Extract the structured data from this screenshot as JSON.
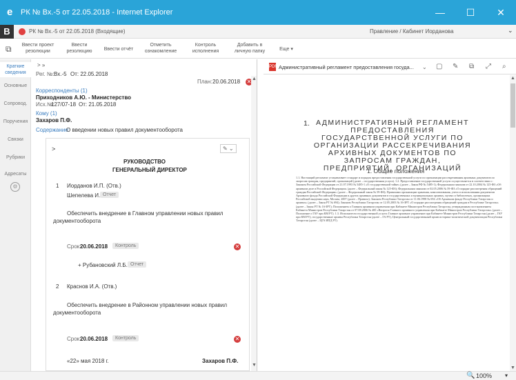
{
  "window": {
    "title": "РК № Вх.-5 от 22.05.2018 - Internet Explorer",
    "minimize": "—",
    "maximize": "☐",
    "close": "✕"
  },
  "tabbar": {
    "logo": "B",
    "tab_title": "РК № Вх.-5 от 22.05.2018 (Входящие)",
    "user": "Правление / Кабинет Иорданова",
    "user_chevron": "⌄"
  },
  "toolbar": {
    "buttons": [
      {
        "line1": "Ввести проект",
        "line2": "резолюции"
      },
      {
        "line1": "Ввести",
        "line2": "резолюцию"
      },
      {
        "line1": "Ввести отчёт",
        "line2": ""
      },
      {
        "line1": "Отметить",
        "line2": "ознакомление"
      },
      {
        "line1": "Контроль",
        "line2": "исполнения"
      },
      {
        "line1": "Добавить в",
        "line2": "личную папку"
      },
      {
        "line1": "Еще ▾",
        "line2": ""
      }
    ]
  },
  "leftnav": {
    "items": [
      {
        "line1": "Краткие",
        "line2": "сведения"
      },
      {
        "line1": "Основные",
        "line2": ""
      },
      {
        "line1": "Сопровод.",
        "line2": ""
      },
      {
        "line1": "Поручения",
        "line2": ""
      },
      {
        "line1": "Связки",
        "line2": ""
      },
      {
        "line1": "Рубрики",
        "line2": ""
      },
      {
        "line1": "Адресаты",
        "line2": ""
      }
    ],
    "gear": "⚙"
  },
  "doc": {
    "nav_arrows": "> »",
    "reg_label": "Рег. №:",
    "reg_number": "Вх.-5",
    "reg_date": "От: 22.05.2018",
    "plan_label": "План:",
    "plan_date": "20.06.2018",
    "correspondents_label": "Корреспонденты (1)",
    "correspondent": "Приходников А.Ю. - Министерство",
    "outgoing_label": "Исх.№:",
    "outgoing_number": "127/07-18",
    "outgoing_date": "От: 21.05.2018",
    "to_label": "Кому (1)",
    "to_person": "Захаров П.Ф.",
    "content_label": "Содержание:",
    "content_text": "О введении новых правил документооборота"
  },
  "resolution": {
    "arrow": ">",
    "edit": "✎ ⌄",
    "heading1": "РУКОВОДСТВО",
    "heading2": "ГЕНЕРАЛЬНЫЙ ДИРЕКТОР",
    "item1_num": "1",
    "item1_person": "Иорданов И.П. (Отв.)",
    "item1_report_badge": "Отчет",
    "item1_coexec": "Шепелева И.Г.",
    "item1_coexec_badge": "Отчет",
    "item1_text1": "Обеспечить внедрение в Главном управлении новых правил",
    "item1_text2": "документооборота",
    "item1_deadline_label": "Срок:",
    "item1_deadline": "20.06.2018",
    "item1_control_badge": "Контроль",
    "item1_sub_person": "+ Рубановский Л.Б.",
    "item1_sub_badge": "Отчет",
    "item2_num": "2",
    "item2_person": "Краснов И.А. (Отв.)",
    "item2_text1": "Обеспечить внедрение в Районном управлении новых правил",
    "item2_text2": "документооборота",
    "item2_deadline_label": "Срок:",
    "item2_deadline": "20.06.2018",
    "item2_control_badge": "Контроль",
    "footer_date": "«22» мая 2018 г.",
    "footer_person": "Захаров П.Ф.",
    "remove_icon": "✕"
  },
  "pdf": {
    "icon_label": "PDF",
    "title": "Административный регламент предоставления госуда...",
    "title_chevron": "⌄",
    "tools": [
      "▢",
      "✎",
      "⧉",
      "⤢",
      "⌕"
    ],
    "num": "1.",
    "heading": "АДМИНИСТРАТИВНЫЙ РЕГЛАМЕНТ ПРЕДОСТАВЛЕНИЯ ГОСУДАРСТВЕННОЙ УСЛУГИ ПО ОРГАНИЗАЦИИ РАССЕКРЕЧИВАНИЯ АРХИВНЫХ ДОКУМЕНТОВ ПО ЗАПРОСАМ ГРАЖДАН, ПРЕДПРИЯТИЙ, ОРГАНИЗАЦИЙ",
    "section": "1. Общие положения",
    "body": "1.1. Настоящий регламент устанавливает стандарт и порядок предоставления государственной услуги по организации рассекречивания архивных документов по запросам граждан, предприятий, организаций (далее – государственная услуга). 1.2. Предоставление государственной услуги осуществляется в соответствии с: Законом Российской Федерации от 21.07.1993 № 5485-1 «О государственной тайне» (далее – Закон РФ № 5485-1); Федеральным законом от 22.10.2004 № 125-ФЗ «Об архивном деле в Российской Федерации» (далее – Федеральный закон № 125-ФЗ); Федеральным законом от 02.05.2006 № 59-ФЗ «О порядке рассмотрения обращений граждан Российской Федерации» (далее – Федеральный закон № 59-ФЗ); Правилами организации хранения, комплектования, учета и использования документов Архивного фонда Российской Федерации и других архивных документов в государственных и муниципальных архивах, музеях и библиотеках, организациях Российской академии наук, Москва, 2007 (далее – Правила); Законом Республики Татарстан от 11.06.1998 № 694 «Об Архивном фонде Республики Татарстан и архивах» (далее – Закон РТ № 694); Законом Республики Татарстан от 12.05.2003 № 16-ЗРТ «О порядке рассмотрения обращений граждан в Республике Татарстан» (далее – Закон РТ № 16-ЗРТ); Положением о Главном архивном управлении при Кабинете Министров Республики Татарстан, утвержденным постановлением Кабинета Министров Республики Татарстан от 07.08.2006 № 400 «Вопросы Главного архивного управления при Кабинете Министров Республики Татарстан» (далее – Положение о ГАУ при КМ РТ). 1.3. Исполнители государственной услуги: Главное архивное управление при Кабинете Министров Республики Татарстан (далее – ГАУ при КМ РТ), государственные архивы Республики Татарстан (далее – ГА РТ), Центральный государственный архив историко-политической документации Республики Татарстан (далее – ЦГА ИПД РТ)."
  },
  "status": {
    "zoom_icon": "🔍",
    "zoom": "100%",
    "zoom_chevron": "▾"
  },
  "colors": {
    "titlebar": "#2aa4d8",
    "link": "#3a7dbf",
    "remove": "#d43c3c",
    "pdf": "#d9342b"
  }
}
